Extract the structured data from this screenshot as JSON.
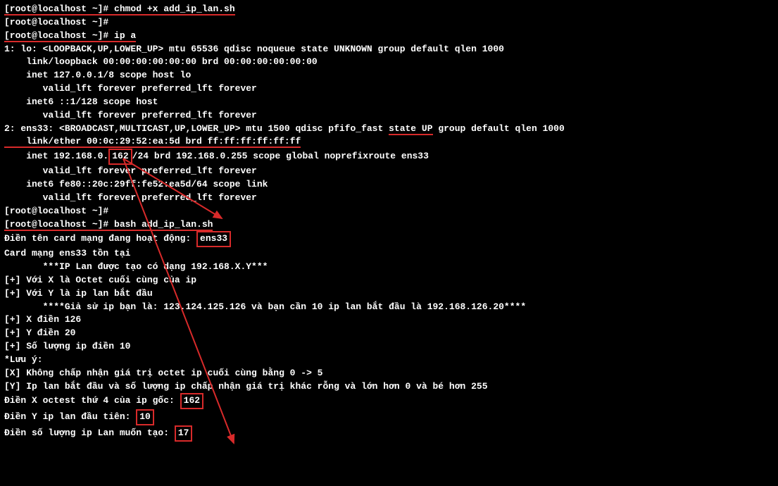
{
  "lines": {
    "l1_prompt": "[root@localhost ~]# ",
    "l1_cmd": "chmod +x add_ip_lan.sh",
    "l2": "[root@localhost ~]#",
    "l3_prompt": "[root@localhost ~]# ",
    "l3_cmd": "ip a",
    "l4": "1: lo: <LOOPBACK,UP,LOWER_UP> mtu 65536 qdisc noqueue state UNKNOWN group default qlen 1000",
    "l5": "    link/loopback 00:00:00:00:00:00 brd 00:00:00:00:00:00",
    "l6": "    inet 127.0.0.1/8 scope host lo",
    "l7": "       valid_lft forever preferred_lft forever",
    "l8": "    inet6 ::1/128 scope host",
    "l9": "       valid_lft forever preferred_lft forever",
    "l10_a": "2: ens33: <BROADCAST,MULTICAST,UP,LOWER_UP> mtu 1500 qdisc pfifo_fast ",
    "l10_state": "state UP",
    "l10_b": " group default qlen 1000",
    "l11": "    link/ether 00:0c:29:52:ea:5d brd ff:ff:ff:ff:ff:ff",
    "l12_a": "    inet 192.168.0.",
    "l12_octet": "162",
    "l12_b": "/24 brd 192.168.0.255 scope global noprefixroute ens33",
    "l13": "       valid_lft forever preferred_lft forever",
    "l14": "    inet6 fe80::20c:29ff:fe52:ea5d/64 scope link",
    "l15": "       valid_lft forever preferred_lft forever",
    "l16": "[root@localhost ~]#",
    "l17_prompt": "[root@localhost ~]# ",
    "l17_cmd": "bash add_ip_lan.sh",
    "l18_a": "Điền tên card mạng đang hoạt động: ",
    "l18_val": "ens33",
    "l19": "Card mạng ens33 tồn tại",
    "l20": "",
    "l21": "       ***IP Lan được tạo có dạng 192.168.X.Y***",
    "l22": "",
    "l23": "[+] Với X là Octet cuối cùng của ip",
    "l24": "[+] Với Y là ip lan bắt đầu",
    "l25": "       ****Giả sử ip bạn là: 123.124.125.126 và bạn cần 10 ip lan bắt đầu là 192.168.126.20****",
    "l26": "[+] X điền 126",
    "l27": "[+] Y điền 20",
    "l28": "[+] Số lượng ip điền 10",
    "l29": "",
    "l30": "*Lưu ý:",
    "l31": "[X] Không chấp nhận giá trị octet ip cuối cùng bằng 0 -> 5",
    "l32": "[Y] Ip lan bắt đầu và số lượng ip chấp nhận giá trị khác rỗng và lớn hơn 0 và bé hơn 255",
    "l33": "",
    "l34_a": "Điền X octest thứ 4 của ip gốc: ",
    "l34_val": "162",
    "l35_a": "Điền Y ip lan đầu tiên: ",
    "l35_val": "10",
    "l36_a": "Điền số lượng ip Lan muốn tạo: ",
    "l36_val": "17"
  },
  "annotation_color": "#d82a2a"
}
